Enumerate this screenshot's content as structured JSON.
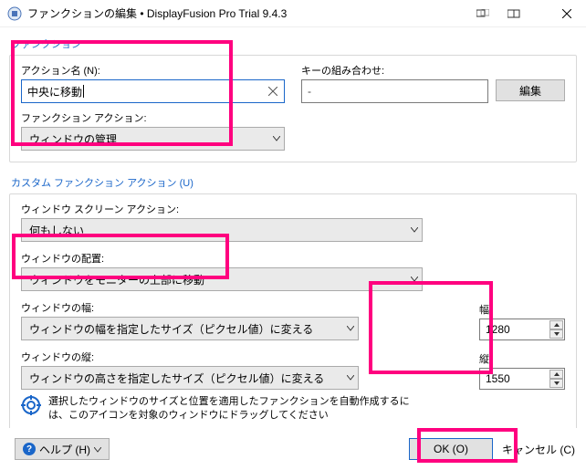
{
  "window": {
    "title": "ファンクションの編集 • DisplayFusion Pro Trial 9.4.3"
  },
  "section1": {
    "legend": "ファンクション",
    "action_name_label": "アクション名 (N):",
    "action_name_value": "中央に移動",
    "key_combo_label": "キーの組み合わせ:",
    "key_combo_value": "-",
    "edit_button": "編集",
    "func_action_label": "ファンクション アクション:",
    "func_action_value": "ウィンドウの管理"
  },
  "section2": {
    "legend": "カスタム ファンクション アクション (U)",
    "screen_action_label": "ウィンドウ スクリーン アクション:",
    "screen_action_value": "何もしない",
    "placement_label": "ウィンドウの配置:",
    "placement_value": "ウィンドウをモニターの上部に移動",
    "width_action_label": "ウィンドウの幅:",
    "width_action_value": "ウィンドウの幅を指定したサイズ（ピクセル値）に変える",
    "width_num_label": "幅:",
    "width_num_value": "1280",
    "height_action_label": "ウィンドウの縦:",
    "height_action_value": "ウィンドウの高さを指定したサイズ（ピクセル値）に変える",
    "height_num_label": "縦:",
    "height_num_value": "1550",
    "info_text": "選択したウィンドウのサイズと位置を適用したファンクションを自動作成するには、このアイコンを対象のウィンドウにドラッグしてください"
  },
  "footer": {
    "help": "ヘルプ (H)",
    "ok": "OK (O)",
    "cancel": "キャンセル (C)"
  }
}
